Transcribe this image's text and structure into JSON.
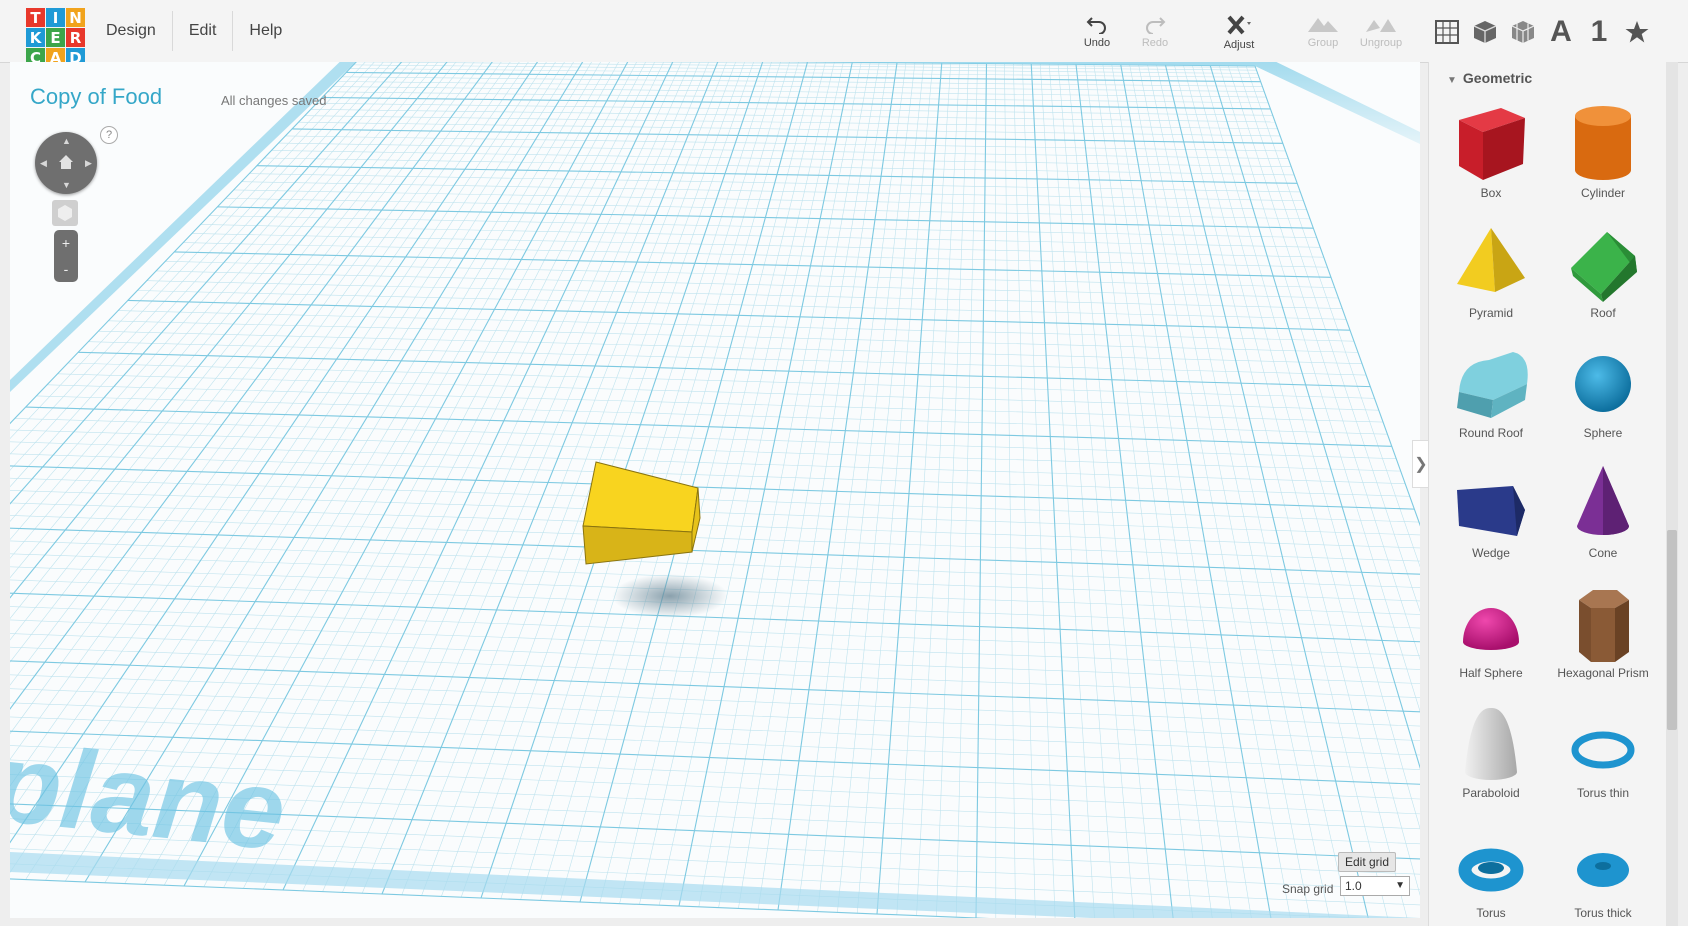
{
  "logo": {
    "letters": [
      "T",
      "I",
      "N",
      "K",
      "E",
      "R",
      "C",
      "A",
      "D"
    ],
    "colors": [
      "#e8382b",
      "#1f9ad6",
      "#f1a31c",
      "#1f9ad6",
      "#3ca54a",
      "#e8382b",
      "#3ca54a",
      "#f1a31c",
      "#1f9ad6"
    ]
  },
  "menu": [
    {
      "id": "design",
      "label": "Design"
    },
    {
      "id": "edit",
      "label": "Edit"
    },
    {
      "id": "help",
      "label": "Help"
    }
  ],
  "toolbar": {
    "undo": "Undo",
    "redo": "Redo",
    "adjust": "Adjust",
    "group": "Group",
    "ungroup": "Ungroup"
  },
  "panel_icons": {
    "text_a": "A",
    "number_one": "1"
  },
  "document": {
    "title": "Copy of Food",
    "status": "All changes saved"
  },
  "nav": {
    "help": "?",
    "zoom_in": "+",
    "zoom_out": "-"
  },
  "workplane": {
    "watermark": "plane"
  },
  "grid": {
    "edit_label": "Edit grid",
    "snap_label": "Snap grid",
    "snap_value": "1.0"
  },
  "panel": {
    "category": "Geometric",
    "shapes": [
      {
        "id": "box",
        "label": "Box",
        "color": "#c81e2a"
      },
      {
        "id": "cylinder",
        "label": "Cylinder",
        "color": "#e6791a"
      },
      {
        "id": "pyramid",
        "label": "Pyramid",
        "color": "#e8c21c"
      },
      {
        "id": "roof",
        "label": "Roof",
        "color": "#2f9a3c"
      },
      {
        "id": "round-roof",
        "label": "Round Roof",
        "color": "#6fc3d3"
      },
      {
        "id": "sphere",
        "label": "Sphere",
        "color": "#1e94cf"
      },
      {
        "id": "wedge",
        "label": "Wedge",
        "color": "#27337a"
      },
      {
        "id": "cone",
        "label": "Cone",
        "color": "#7b2f95"
      },
      {
        "id": "half-sphere",
        "label": "Half Sphere",
        "color": "#d11b8a"
      },
      {
        "id": "hexagonal-prism",
        "label": "Hexagonal Prism",
        "color": "#8a5a36"
      },
      {
        "id": "paraboloid",
        "label": "Paraboloid",
        "color": "#d8d8d8"
      },
      {
        "id": "torus-thin",
        "label": "Torus thin",
        "color": "#1e94cf"
      },
      {
        "id": "torus",
        "label": "Torus",
        "color": "#1e94cf"
      },
      {
        "id": "torus-thick",
        "label": "Torus thick",
        "color": "#1e94cf"
      }
    ]
  },
  "colors": {
    "accent": "#35a7c8",
    "grid_line": "#8fd0e6",
    "object": "#f4d21e"
  }
}
